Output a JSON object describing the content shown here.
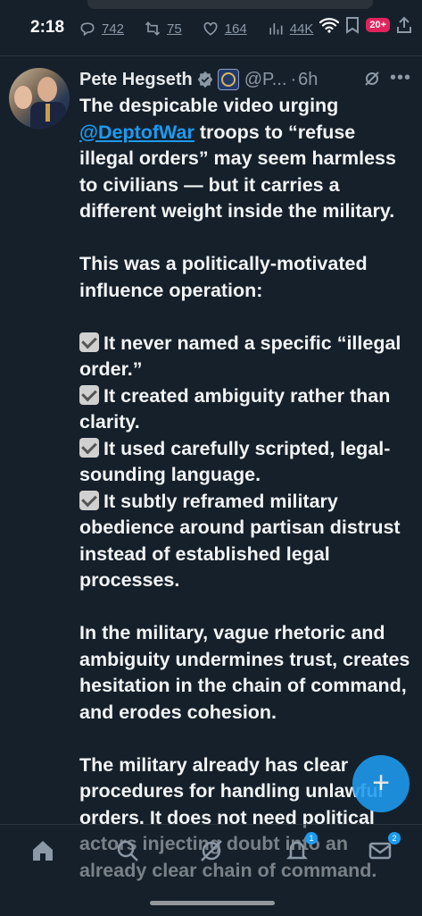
{
  "status_bar": {
    "time": "2:18",
    "battery": "20+"
  },
  "previous_tweet_actions": {
    "replies": "742",
    "reposts": "75",
    "likes": "164",
    "views": "44K"
  },
  "tweet": {
    "display_name": "Pete Hegseth",
    "handle": "@P...",
    "separator": "·",
    "time": "6h",
    "paragraph1_pre": "The despicable video urging ",
    "mention": "@DeptofWar",
    "paragraph1_post": " troops to “refuse illegal orders” may seem harmless to civilians — but it carries a different weight inside the military.",
    "paragraph2": "This was a politically-motivated influence operation:",
    "bullets": [
      "It never named a specific “illegal order.”",
      "It created ambiguity rather than clarity.",
      "It used carefully scripted, legal-sounding language.",
      "It subtly reframed military obedience around partisan distrust instead of established legal processes."
    ],
    "paragraph3": "In the military, vague rhetoric and ambiguity undermines trust, creates hesitation in the chain of command, and erodes cohesion.",
    "paragraph4": "The military already has clear procedures for handling unlawful orders. It does not need political actors injecting doubt into an already clear chain of command."
  },
  "compose_button": {
    "label": "+"
  },
  "bottom_nav": {
    "notifications_badge": "1",
    "messages_badge": "2"
  },
  "colors": {
    "background": "#15202b",
    "accent": "#1d9bf0",
    "text": "#e7e9ea",
    "muted": "#8b98a5"
  },
  "icons": [
    "reply-icon",
    "repost-icon",
    "like-icon",
    "views-icon",
    "verified-icon",
    "grok-icon",
    "more-icon",
    "home-icon",
    "search-icon",
    "grok-nav-icon",
    "notifications-icon",
    "messages-icon"
  ]
}
